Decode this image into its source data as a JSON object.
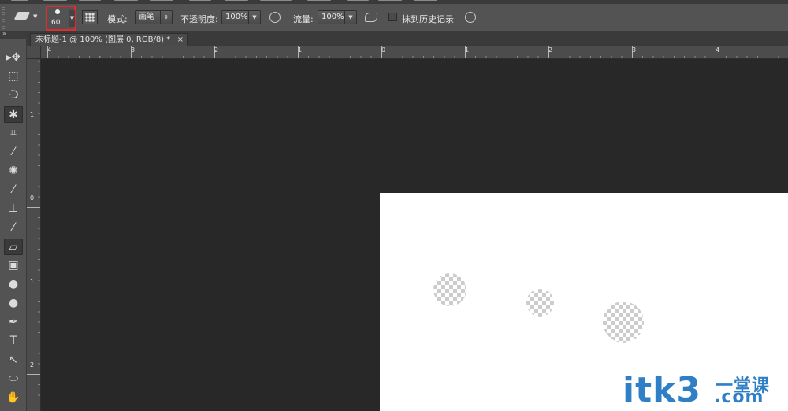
{
  "options_bar": {
    "brush_size": "60",
    "mode_label": "模式:",
    "mode_value": "画笔",
    "opacity_label": "不透明度:",
    "opacity_value": "100%",
    "flow_label": "流量:",
    "flow_value": "100%",
    "erase_history_label": "抹到历史记录"
  },
  "document_tab": {
    "title": "未标题-1 @ 100% (图层 0, RGB/8) *",
    "close": "×"
  },
  "rulers": {
    "horizontal_ticks": [
      "4",
      "3",
      "2",
      "1",
      "0",
      "1",
      "2",
      "3",
      "4"
    ],
    "vertical_ticks": [
      "1",
      "0",
      "1",
      "2"
    ]
  },
  "toolbar": {
    "tools": [
      {
        "name": "move-tool-icon",
        "glyph": "▸✥"
      },
      {
        "name": "marquee-tool-icon",
        "glyph": "⬚"
      },
      {
        "name": "lasso-tool-icon",
        "glyph": "ᑝ"
      },
      {
        "name": "magic-wand-tool-icon",
        "glyph": "✱"
      },
      {
        "name": "crop-tool-icon",
        "glyph": "⌗"
      },
      {
        "name": "eyedropper-tool-icon",
        "glyph": "⁄"
      },
      {
        "name": "healing-tool-icon",
        "glyph": "✺"
      },
      {
        "name": "brush-tool-icon",
        "glyph": "⁄"
      },
      {
        "name": "stamp-tool-icon",
        "glyph": "⊥"
      },
      {
        "name": "history-brush-tool-icon",
        "glyph": "⁄"
      },
      {
        "name": "eraser-tool-icon",
        "glyph": "▱"
      },
      {
        "name": "gradient-tool-icon",
        "glyph": "▣"
      },
      {
        "name": "blur-tool-icon",
        "glyph": "●"
      },
      {
        "name": "dodge-tool-icon",
        "glyph": "●"
      },
      {
        "name": "pen-tool-icon",
        "glyph": "✒"
      },
      {
        "name": "type-tool-icon",
        "glyph": "T"
      },
      {
        "name": "path-selection-tool-icon",
        "glyph": "↖"
      },
      {
        "name": "ellipse-tool-icon",
        "glyph": "⬭"
      },
      {
        "name": "hand-tool-icon",
        "glyph": "✋"
      }
    ]
  },
  "watermark": {
    "text": "itk3",
    "cn_text": "一堂课",
    "com_text": ".com"
  },
  "colors": {
    "highlight": "#e02c2c",
    "watermark": "#2f7fc7"
  }
}
